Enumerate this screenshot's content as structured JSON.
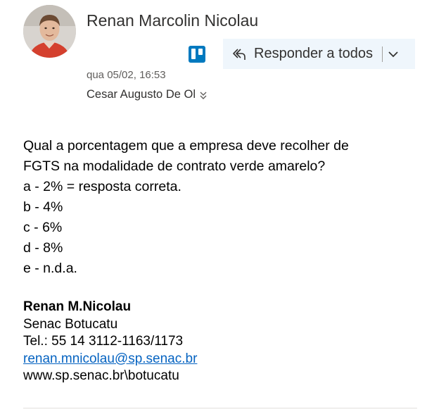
{
  "header": {
    "sender_name": "Renan Marcolin Nicolau",
    "avatar_icon": "person-photo",
    "date": "qua 05/02, 16:53",
    "recipient": "Cesar Augusto De Ol",
    "recipient_expand_icon": "double-chevron-down-icon"
  },
  "toolbar": {
    "trello_icon": "trello-icon",
    "reply_all_label": "Responder a todos",
    "reply_all_icon": "reply-all-icon",
    "more_icon": "chevron-down-icon"
  },
  "message": {
    "lines": [
      "Qual a porcentagem que a empresa deve recolher de",
      "FGTS na modalidade de contrato verde amarelo?",
      "a - 2% = resposta correta.",
      "b - 4%",
      "c - 6%",
      "d - 8%",
      "e - n.d.a."
    ]
  },
  "signature": {
    "name": "Renan M.Nicolau",
    "org": "Senac Botucatu",
    "phone": "Tel.: 55 14 3112-1163/1173",
    "email": "renan.mnicolau@sp.senac.br",
    "website": "www.sp.senac.br\\botucatu"
  },
  "colors": {
    "reply_button_bg": "#eff6fc",
    "trello_blue": "#0079bf",
    "link": "#0563c1"
  }
}
